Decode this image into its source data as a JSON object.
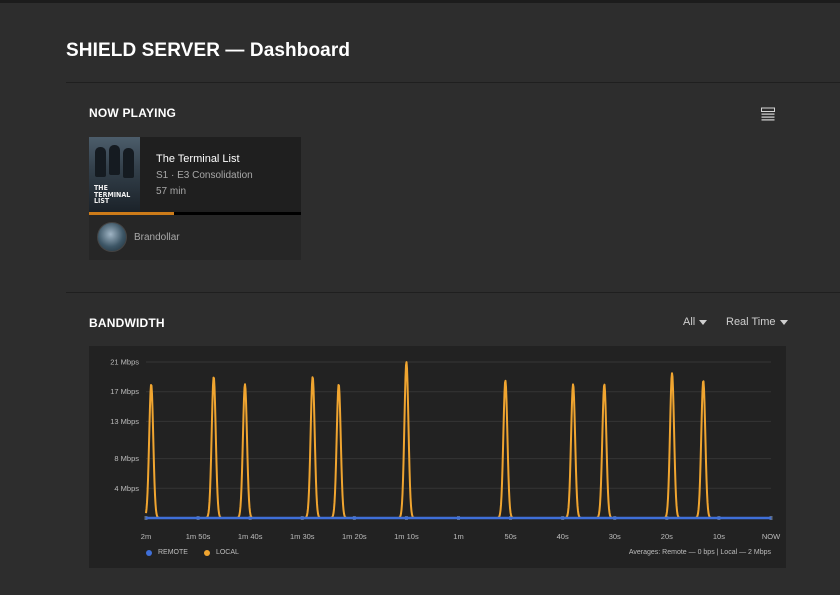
{
  "page": {
    "title": "SHIELD SERVER — Dashboard"
  },
  "now_playing": {
    "section_title": "NOW PLAYING",
    "view_icon": "list-view-icon",
    "item": {
      "poster_text": "THE TERMINAL LIST",
      "title": "The Terminal List",
      "subtitle": "S1 · E3 Consolidation",
      "duration": "57 min",
      "progress": 0.4,
      "user": "Brandollar"
    }
  },
  "bandwidth": {
    "section_title": "BANDWIDTH",
    "filter": "All",
    "range": "Real Time",
    "legend": {
      "remote": "REMOTE",
      "local": "LOCAL"
    },
    "averages": "Averages: Remote — 0 bps | Local — 2 Mbps"
  },
  "colors": {
    "local": "#f0a530",
    "remote": "#3f6fd8",
    "accent": "#cc7b19"
  },
  "chart_data": {
    "type": "line",
    "title": "",
    "xlabel": "",
    "ylabel": "",
    "x_ticks": [
      "2m",
      "1m 50s",
      "1m 40s",
      "1m 30s",
      "1m 20s",
      "1m 10s",
      "1m",
      "50s",
      "40s",
      "30s",
      "20s",
      "10s",
      "NOW"
    ],
    "y_ticks": [
      "21 Mbps",
      "17 Mbps",
      "13 Mbps",
      "8 Mbps",
      "4 Mbps"
    ],
    "y_tick_values": [
      21,
      17,
      13,
      8,
      4
    ],
    "ylim": [
      0,
      21
    ],
    "xlim_seconds_ago": [
      120,
      0
    ],
    "grid": true,
    "legend_position": "bottom-left",
    "series": [
      {
        "name": "LOCAL",
        "peaks_seconds_ago": [
          119,
          107,
          101,
          88,
          83,
          70,
          51,
          38,
          32,
          19,
          13
        ],
        "peak_values": [
          18,
          19,
          18,
          19,
          18,
          21,
          18.5,
          18,
          18,
          19.5,
          18.5
        ],
        "baseline": 0
      },
      {
        "name": "REMOTE",
        "constant_value": 0
      }
    ]
  }
}
